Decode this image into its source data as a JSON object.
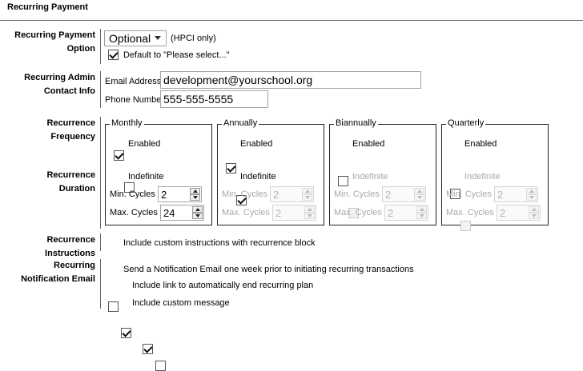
{
  "section_title": "Recurring Payment",
  "option": {
    "label_line1": "Recurring Payment",
    "label_line2": "Option",
    "select_value": "Optional",
    "hint": "(HPCI only)",
    "default_checkbox_label": "Default to \"Please select...\""
  },
  "contact": {
    "label_line1": "Recurring Admin",
    "label_line2": "Contact Info",
    "email_label": "Email Address",
    "email_value": "development@yourschool.org",
    "phone_label": "Phone Number",
    "phone_value": "555-555-5555"
  },
  "frequency_label": {
    "line1": "Recurrence",
    "line2": "Frequency"
  },
  "duration_label": {
    "line1": "Recurrence",
    "line2": "Duration"
  },
  "enabled_label": "Enabled",
  "indefinite_label": "Indefinite",
  "min_cycles_label": "Min. Cycles",
  "max_cycles_label": "Max. Cycles",
  "panels": [
    {
      "name": "Monthly",
      "enabled": true,
      "indefinite": false,
      "min": "2",
      "max": "24"
    },
    {
      "name": "Annually",
      "enabled": true,
      "indefinite": true,
      "min": "2",
      "max": "2"
    },
    {
      "name": "Biannually",
      "enabled": false,
      "indefinite": false,
      "min": "2",
      "max": "2"
    },
    {
      "name": "Quarterly",
      "enabled": false,
      "indefinite": false,
      "min": "2",
      "max": "2"
    }
  ],
  "instructions": {
    "label_line1": "Recurrence",
    "label_line2": "Instructions",
    "checkbox_label": "Include custom instructions with recurrence block"
  },
  "notification": {
    "label_line1": "Recurring",
    "label_line2": "Notification Email",
    "send_label": "Send a Notification Email one week prior to initiating recurring transactions",
    "link_label": "Include link to automatically end recurring plan",
    "custom_label": "Include custom message"
  }
}
